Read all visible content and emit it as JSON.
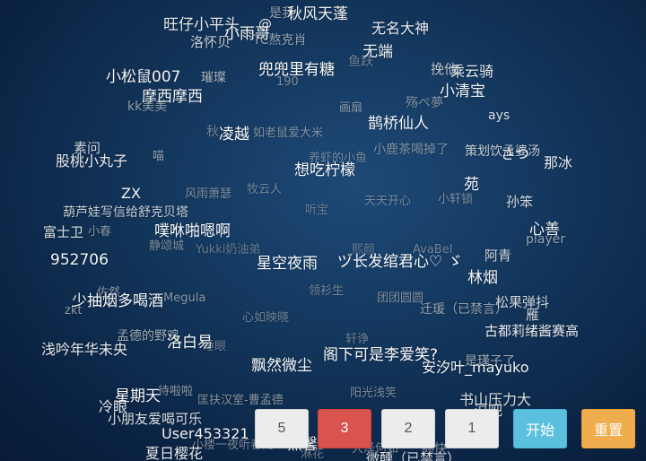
{
  "names": [
    "是我",
    "秋风天蓬",
    "旺仔小平头",
    "@",
    "小雨哥",
    "无名大神",
    "洛怀贝",
    "TC熬克肖",
    "无端",
    "鱼跃",
    "挽他",
    "乘云骑",
    "小松鼠007",
    "璀璨",
    "190",
    "兜兜里有糖",
    "小清宝",
    "摩西摩西",
    "kk美美",
    "殇ぺ夢",
    "画扇",
    "ays",
    "秋",
    "凌越",
    "如老鼠爱大米",
    "鹊桥仙人",
    "素问",
    "小鹿茶喝掉了",
    "策划饮孟婆汤",
    "さつ",
    "股桃小丸子",
    "喵",
    "养虾的小鱼",
    "那冰",
    "想吃柠檬",
    "ZX",
    "风雨萧瑟",
    "牧云人",
    "苑",
    "孙笨",
    "天天开心",
    "小轩锁",
    "葫芦娃写信给舒克贝塔",
    "听宝",
    "心善",
    "富士卫",
    "小春",
    "噗咻啪嗯啊",
    "player",
    "静颂城",
    "Yukki奶油弟",
    "熙颜",
    "AvaBel",
    "阿青",
    "952706",
    "星空夜雨",
    "ヅ长发绾君心♡ ゞ",
    "林烟",
    "佐然",
    "领衫生",
    "少抽烟多喝酒",
    "Megula",
    "团团圆圆",
    "松果弹抖",
    "zkt",
    "迁瑗（已禁言）",
    "雁",
    "心如映晓",
    "孟德的野鸡",
    "古都莉绪酱赛高",
    "洛白易",
    "浅吟年华未央",
    "睡眼",
    "轩诤",
    "飘然微尘",
    "阁下可是李爱笑?",
    "安汐叶_mayuko",
    "是瑾子了",
    "星期天",
    "待啦啦",
    "阳光浅笑",
    "冷眼",
    "匡扶汉室-曹孟德",
    "书山压力大",
    "小朋友爱喝可乐",
    "路径",
    "逗吧",
    "User453321",
    "夏日樱花",
    "小楼一夜听春雨",
    "黑馨",
    "大泽何如",
    "颇快",
    "微醺（已禁言）",
    "淋花"
  ],
  "controls": {
    "count_options": [
      "5",
      "3",
      "2",
      "1"
    ],
    "selected_count": "3",
    "start_label": "开始",
    "reset_label": "重置"
  },
  "colors": {
    "background": "#123459",
    "active_count": "#d9534f",
    "start": "#5bc0de",
    "reset": "#f0ad4e"
  }
}
